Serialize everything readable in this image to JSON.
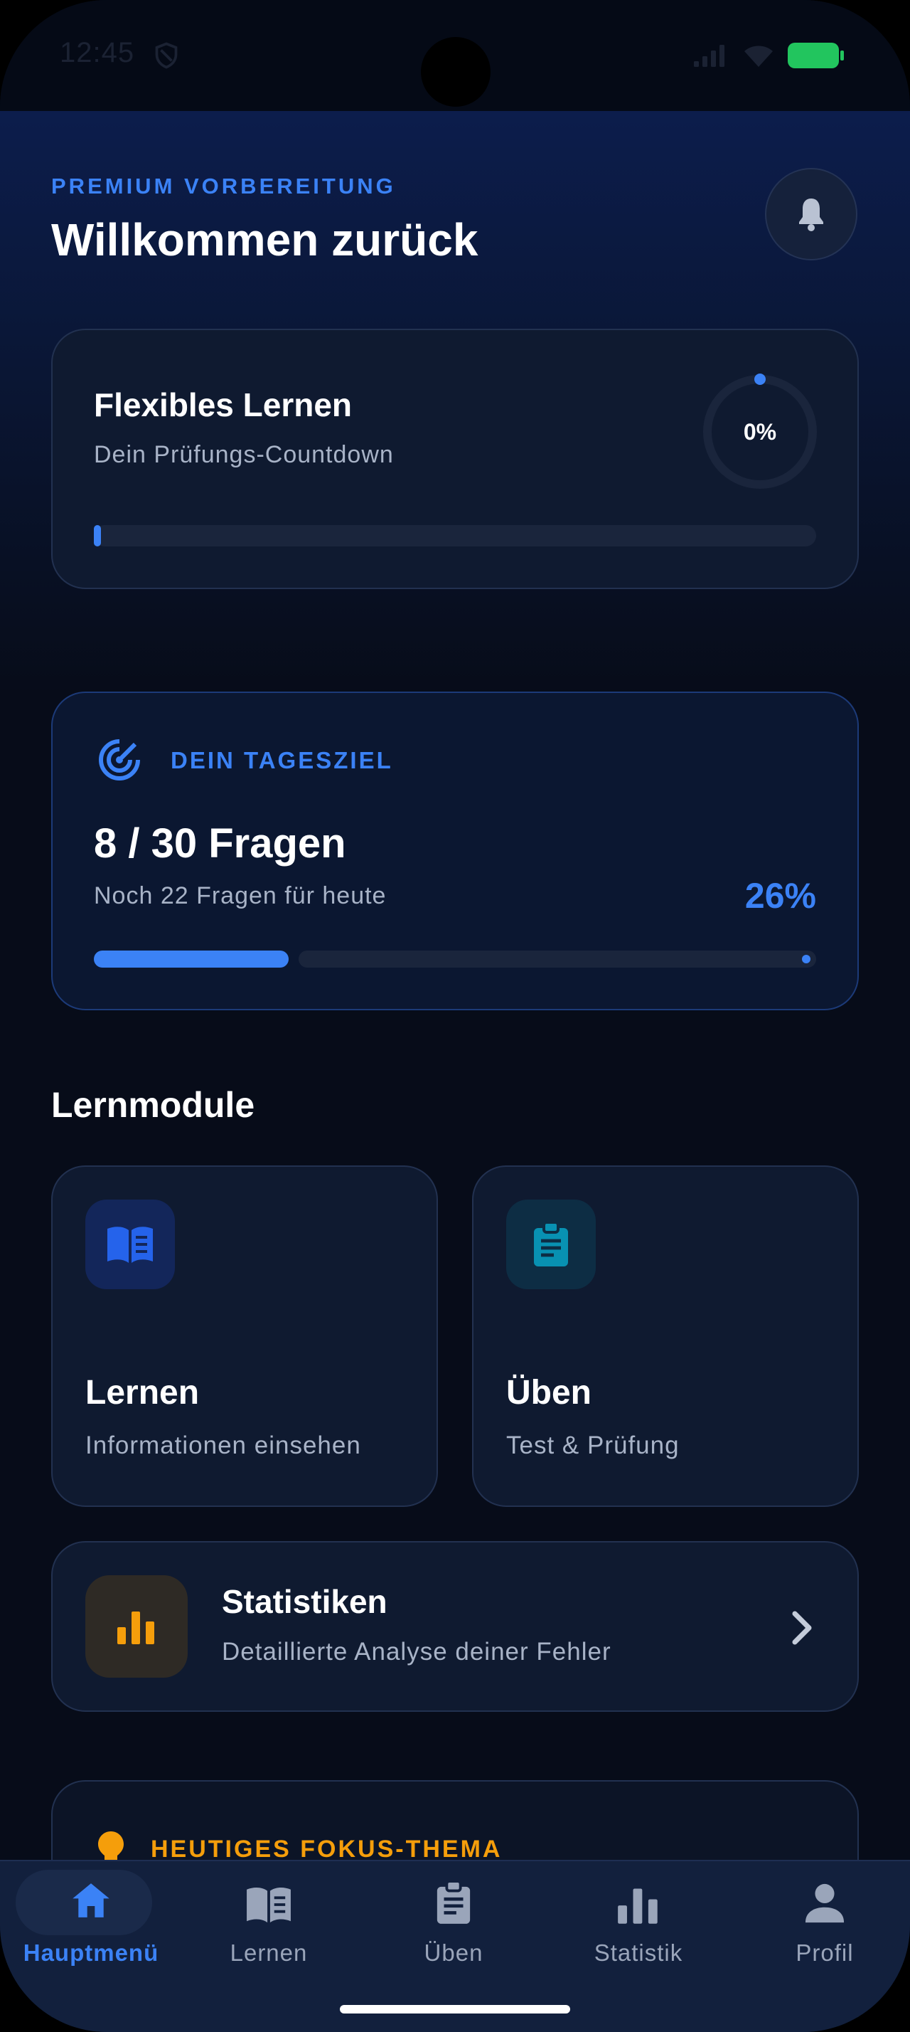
{
  "status_bar": {
    "time": "12:45"
  },
  "header": {
    "eyebrow": "PREMIUM VORBEREITUNG",
    "title": "Willkommen zurück"
  },
  "countdown": {
    "title": "Flexibles Lernen",
    "subtitle": "Dein Prüfungs-Countdown",
    "percent_label": "0%",
    "progress": 0
  },
  "daily_goal": {
    "label": "DEIN TAGESZIEL",
    "count": "8 / 30 Fragen",
    "subtitle": "Noch 22 Fragen für heute",
    "percent_label": "26%",
    "progress": 0.26
  },
  "modules_section": {
    "title": "Lernmodule"
  },
  "modules": [
    {
      "title": "Lernen",
      "subtitle": "Informationen einsehen",
      "icon": "book-icon",
      "color": "#2563eb"
    },
    {
      "title": "Üben",
      "subtitle": "Test & Prüfung",
      "icon": "clipboard-icon",
      "color": "#0891b2"
    }
  ],
  "statistics_card": {
    "title": "Statistiken",
    "subtitle": "Detaillierte Analyse deiner Fehler",
    "icon": "bar-chart-icon",
    "color": "#f59e0b"
  },
  "focus_card": {
    "label": "HEUTIGES FOKUS-THEMA",
    "icon": "lightbulb-icon"
  },
  "bottom_nav": [
    {
      "label": "Hauptmenü",
      "icon": "home-icon",
      "active": true
    },
    {
      "label": "Lernen",
      "icon": "book-icon",
      "active": false
    },
    {
      "label": "Üben",
      "icon": "clipboard-icon",
      "active": false
    },
    {
      "label": "Statistik",
      "icon": "bar-chart-icon",
      "active": false
    },
    {
      "label": "Profil",
      "icon": "person-icon",
      "active": false
    }
  ],
  "colors": {
    "accent": "#3b82f6",
    "background": "#070c19",
    "card": "#0f1a30",
    "focus": "#f59e0b"
  }
}
